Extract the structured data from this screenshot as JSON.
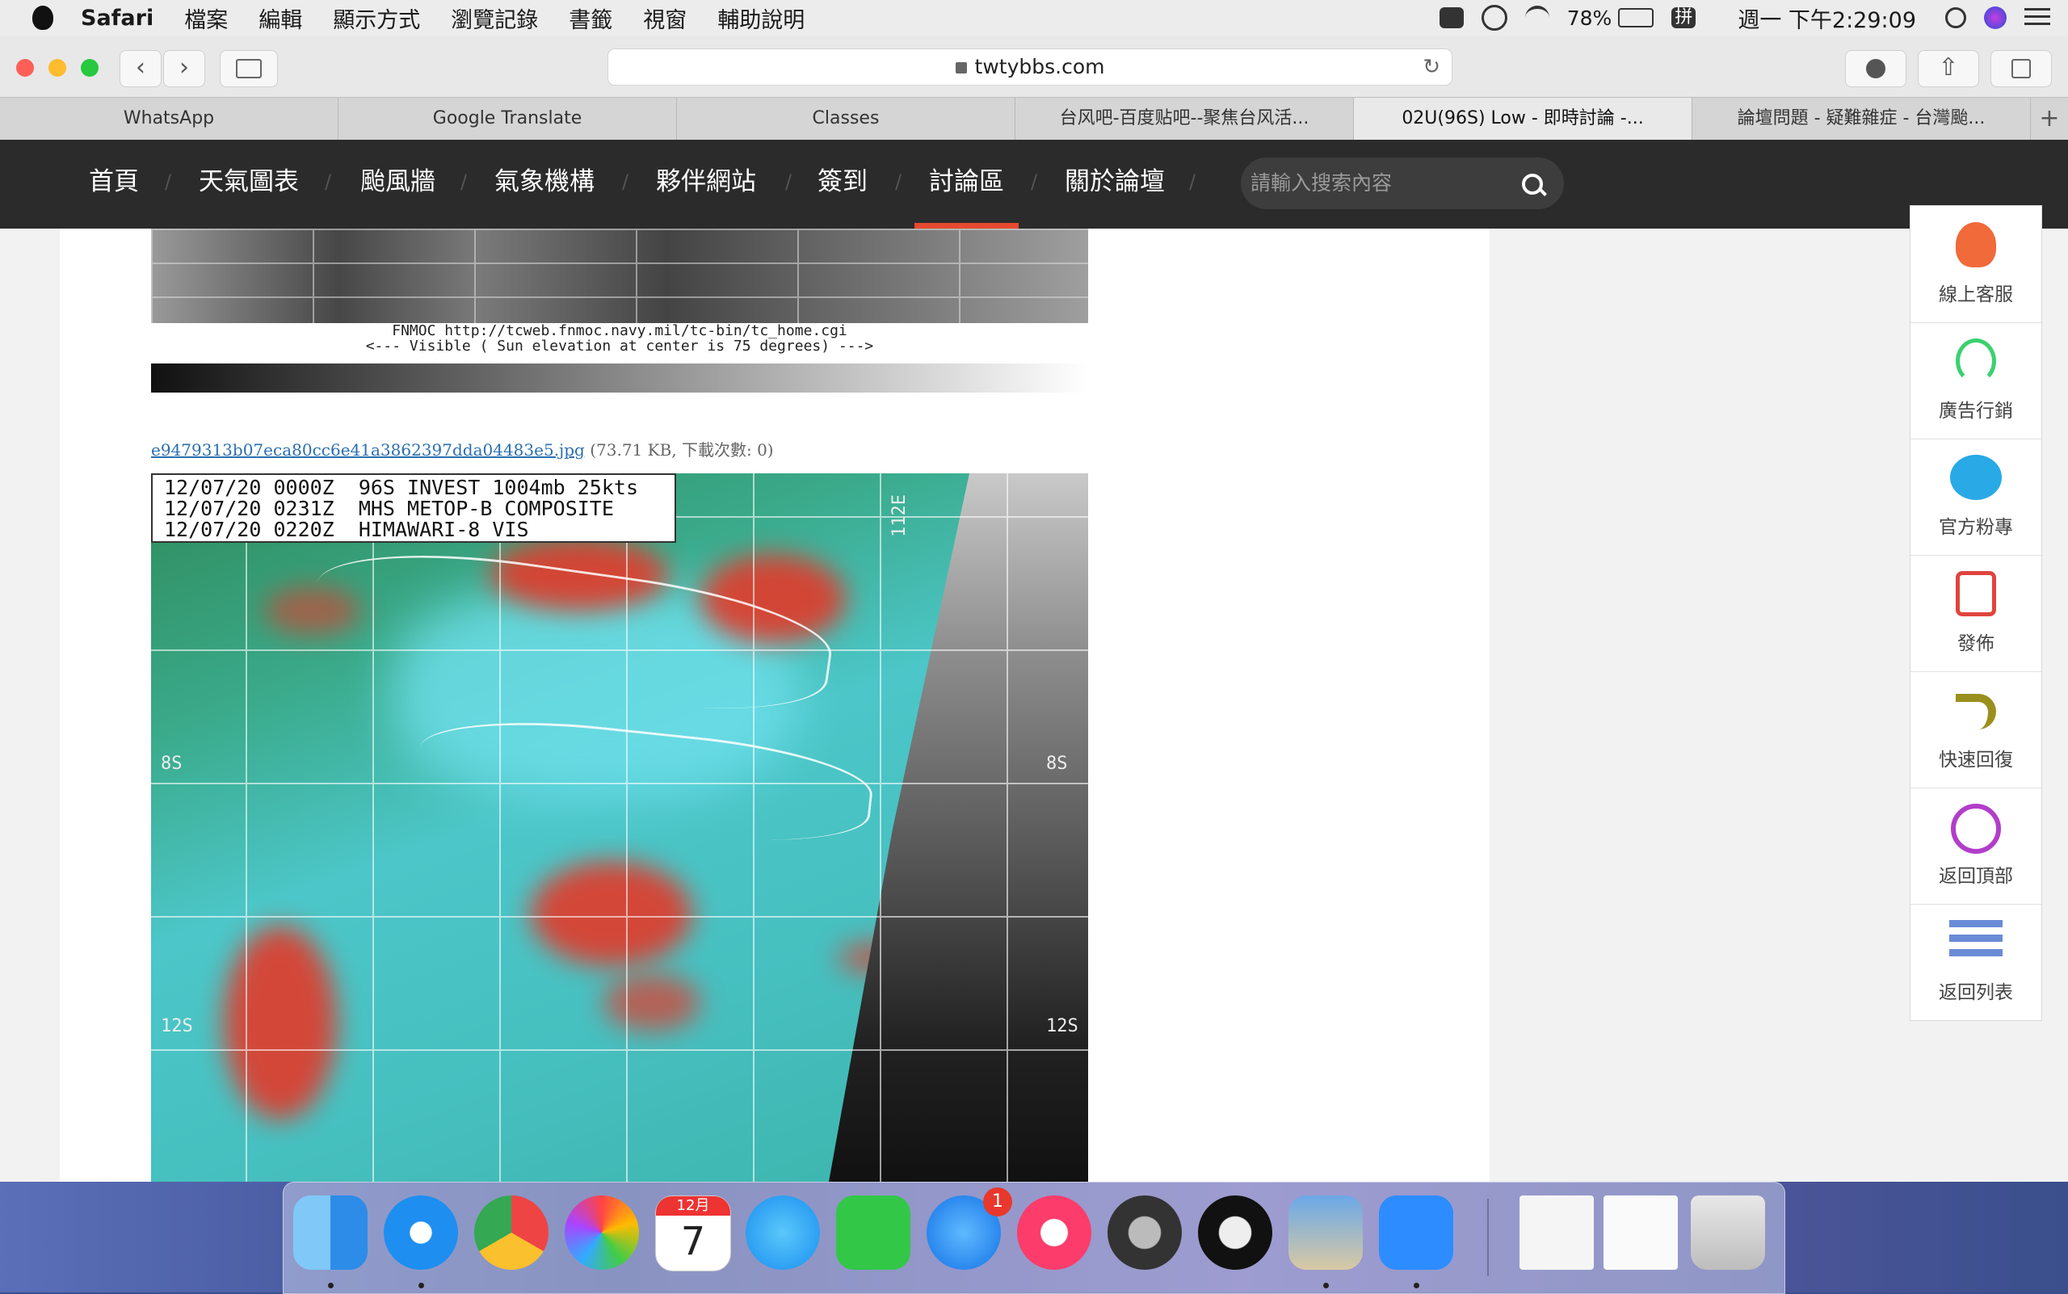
{
  "menubar": {
    "app": "Safari",
    "items": [
      "檔案",
      "編輯",
      "顯示方式",
      "瀏覽記錄",
      "書籤",
      "視窗",
      "輔助說明"
    ],
    "battery": "78%",
    "input_method": "拼",
    "clock": "週一 下午2:29:09"
  },
  "browser": {
    "url": "twtybbs.com",
    "tabs": [
      {
        "label": "WhatsApp"
      },
      {
        "label": "Google Translate"
      },
      {
        "label": "Classes"
      },
      {
        "label": "台风吧-百度贴吧--聚焦台风活..."
      },
      {
        "label": "02U(96S) Low - 即時討論 -..."
      },
      {
        "label": "論壇問題 - 疑難雜症 - 台灣颱..."
      }
    ],
    "new_tab": "+"
  },
  "sitenav": {
    "items": [
      "首頁",
      "天氣圖表",
      "颱風牆",
      "氣象機構",
      "夥伴網站",
      "簽到",
      "討論區",
      "關於論壇"
    ],
    "active_index": 6,
    "search_placeholder": "請輸入搜索內容"
  },
  "post": {
    "image1_caption_line1": "FNMOC http://tcweb.fnmoc.navy.mil/tc-bin/tc_home.cgi",
    "image1_caption_line2": "<--- Visible ( Sun elevation at center is 75 degrees) --->",
    "attachment": {
      "filename": "e9479313b07eca80cc6e41a3862397dda04483e5.jpg",
      "meta": "(73.71 KB, 下載次數: 0)"
    },
    "image2_header": "12/07/20 0000Z  96S INVEST 1004mb 25kts\n12/07/20 0231Z  MHS METOP-B COMPOSITE\n12/07/20 0220Z  HIMAWARI-8 VIS",
    "lat_labels": [
      "8S",
      "12S",
      "8S",
      "12S"
    ],
    "lon_label": "112E"
  },
  "sidepanel": {
    "items": [
      {
        "label": "線上客服",
        "icon": "customer-service-icon",
        "color": "#f06a3a"
      },
      {
        "label": "廣告行銷",
        "icon": "headset-icon",
        "color": "#3bd16f"
      },
      {
        "label": "官方粉專",
        "icon": "chat-bubbles-icon",
        "color": "#29a9e6"
      },
      {
        "label": "發佈",
        "icon": "edit-icon",
        "color": "#e0443e"
      },
      {
        "label": "快速回復",
        "icon": "reply-arrow-icon",
        "color": "#9a8f1e"
      },
      {
        "label": "返回頂部",
        "icon": "up-circle-icon",
        "color": "#b23ec9"
      },
      {
        "label": "返回列表",
        "icon": "list-icon",
        "color": "#6a8bd6"
      }
    ]
  },
  "dock": {
    "calendar_month": "12月",
    "calendar_day": "7",
    "appstore_badge": "1"
  }
}
